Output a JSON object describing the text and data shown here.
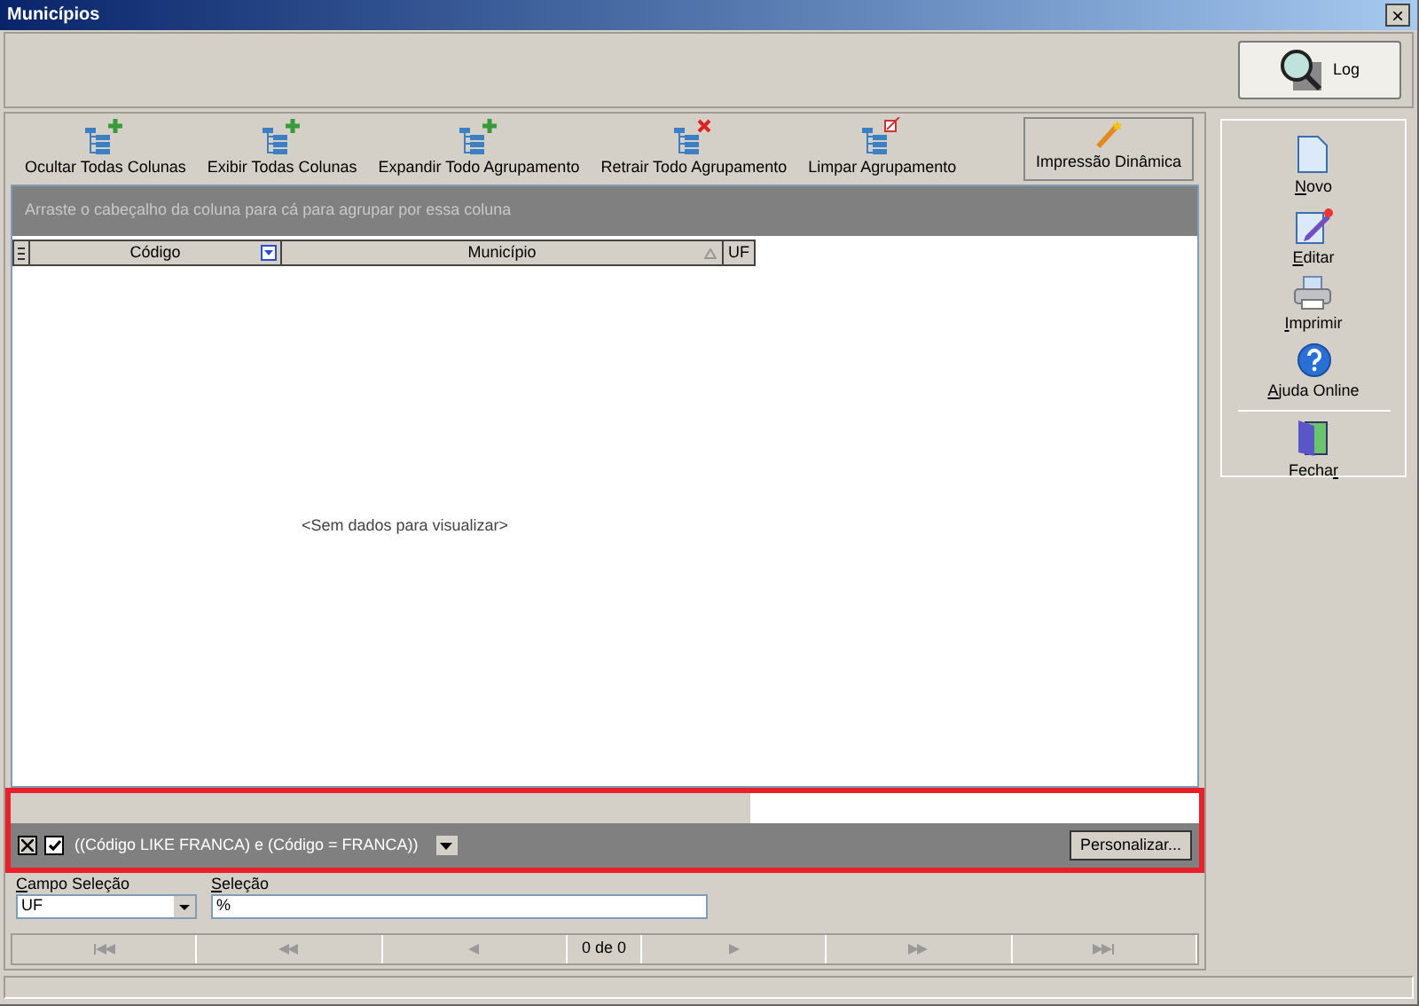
{
  "window": {
    "title": "Municípios",
    "close": "×"
  },
  "log_button": {
    "label": "Log"
  },
  "toolbar": [
    {
      "label": "Ocultar Todas Colunas",
      "kind": "add"
    },
    {
      "label": "Exibir Todas  Colunas",
      "kind": "add"
    },
    {
      "label": "Expandir Todo Agrupamento",
      "kind": "add"
    },
    {
      "label": "Retrair Todo Agrupamento",
      "kind": "remove"
    },
    {
      "label": "Limpar Agrupamento",
      "kind": "clear"
    }
  ],
  "print_button": {
    "label": "Impressão Dinâmica"
  },
  "group_panel": {
    "hint": "Arraste o cabeçalho da coluna para cá para agrupar por essa coluna"
  },
  "table": {
    "columns": [
      {
        "label": "Código",
        "filtered": true,
        "sorted": false
      },
      {
        "label": "Município",
        "filtered": false,
        "sorted": true
      },
      {
        "label": "UF",
        "filtered": false,
        "sorted": false
      }
    ],
    "empty_text": "<Sem dados para visualizar>"
  },
  "filter_bar": {
    "enabled": true,
    "expression": "((Código LIKE FRANCA) e (Código = FRANCA))",
    "customize": "Personalizar..."
  },
  "selection_field": {
    "label": {
      "key": "C",
      "after": "ampo Seleção"
    },
    "value": "UF"
  },
  "selection_value": {
    "label": {
      "key": "S",
      "after": "eleção"
    },
    "value": "%"
  },
  "navigator": {
    "counter": "0 de 0"
  },
  "actions": [
    {
      "label": {
        "key": "N",
        "after": "ovo"
      },
      "kind": "new"
    },
    {
      "label": {
        "key": "E",
        "after": "ditar"
      },
      "kind": "edit"
    },
    {
      "label": {
        "key": "I",
        "after": "mprimir"
      },
      "kind": "print"
    },
    {
      "label": {
        "key": "A",
        "after": "juda Online"
      },
      "kind": "help"
    },
    {
      "label": {
        "before": "Fecha",
        "key": "r"
      },
      "kind": "close"
    }
  ]
}
